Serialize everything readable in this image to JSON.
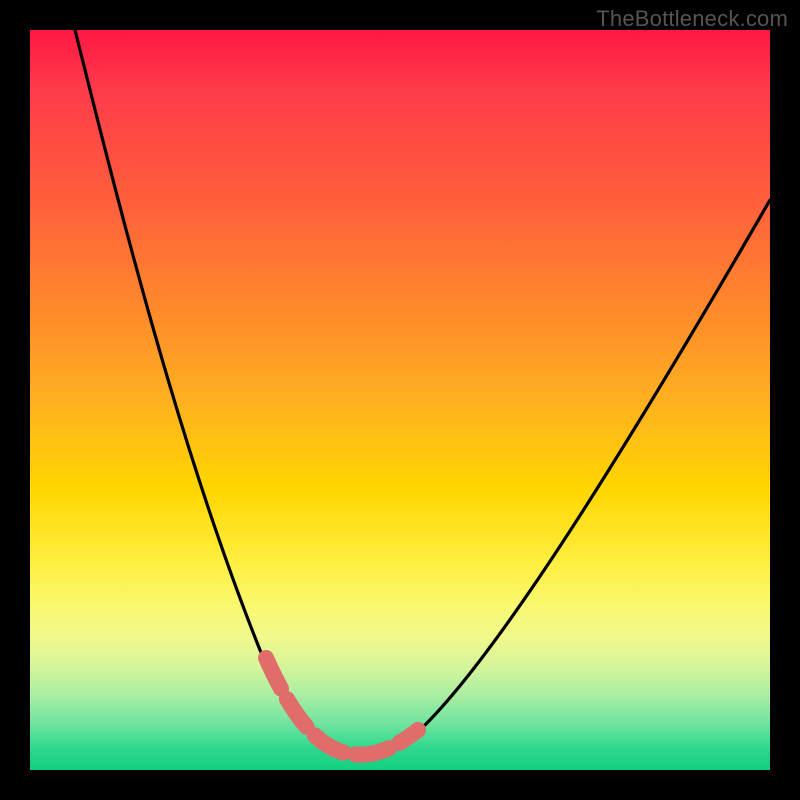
{
  "watermark": "TheBottleneck.com",
  "chart_data": {
    "type": "line",
    "title": "",
    "xlabel": "",
    "ylabel": "",
    "xlim": [
      0,
      100
    ],
    "ylim": [
      0,
      100
    ],
    "legend": false,
    "grid": false,
    "description": "V-shaped bottleneck curve over a red-to-green vertical gradient. Left branch descends steeply from top-left toward a minimum around x≈40; right branch rises toward the upper-right. Minimum region (≈x 35–50) is highlighted with a thick salmon stroke near the bottom.",
    "series": [
      {
        "name": "bottleneck-curve",
        "x": [
          5,
          10,
          15,
          20,
          25,
          30,
          35,
          38,
          40,
          42,
          45,
          48,
          52,
          58,
          65,
          72,
          80,
          88,
          95,
          100
        ],
        "values": [
          100,
          85,
          70,
          55,
          40,
          25,
          12,
          6,
          4,
          4,
          5,
          6,
          10,
          18,
          28,
          38,
          50,
          62,
          72,
          80
        ]
      }
    ],
    "highlight": {
      "name": "minimum-band",
      "x": [
        33,
        36,
        39,
        42,
        45,
        48,
        51
      ],
      "values": [
        12,
        7,
        4,
        3,
        4,
        6,
        9
      ],
      "color": "#e06c6c"
    },
    "gradient_stops": [
      {
        "pos": 0,
        "color": "#ff1744"
      },
      {
        "pos": 22,
        "color": "#ff5c3d"
      },
      {
        "pos": 50,
        "color": "#ffb020"
      },
      {
        "pos": 72,
        "color": "#ffef41"
      },
      {
        "pos": 90,
        "color": "#a8eea3"
      },
      {
        "pos": 100,
        "color": "#12cf7f"
      }
    ]
  }
}
